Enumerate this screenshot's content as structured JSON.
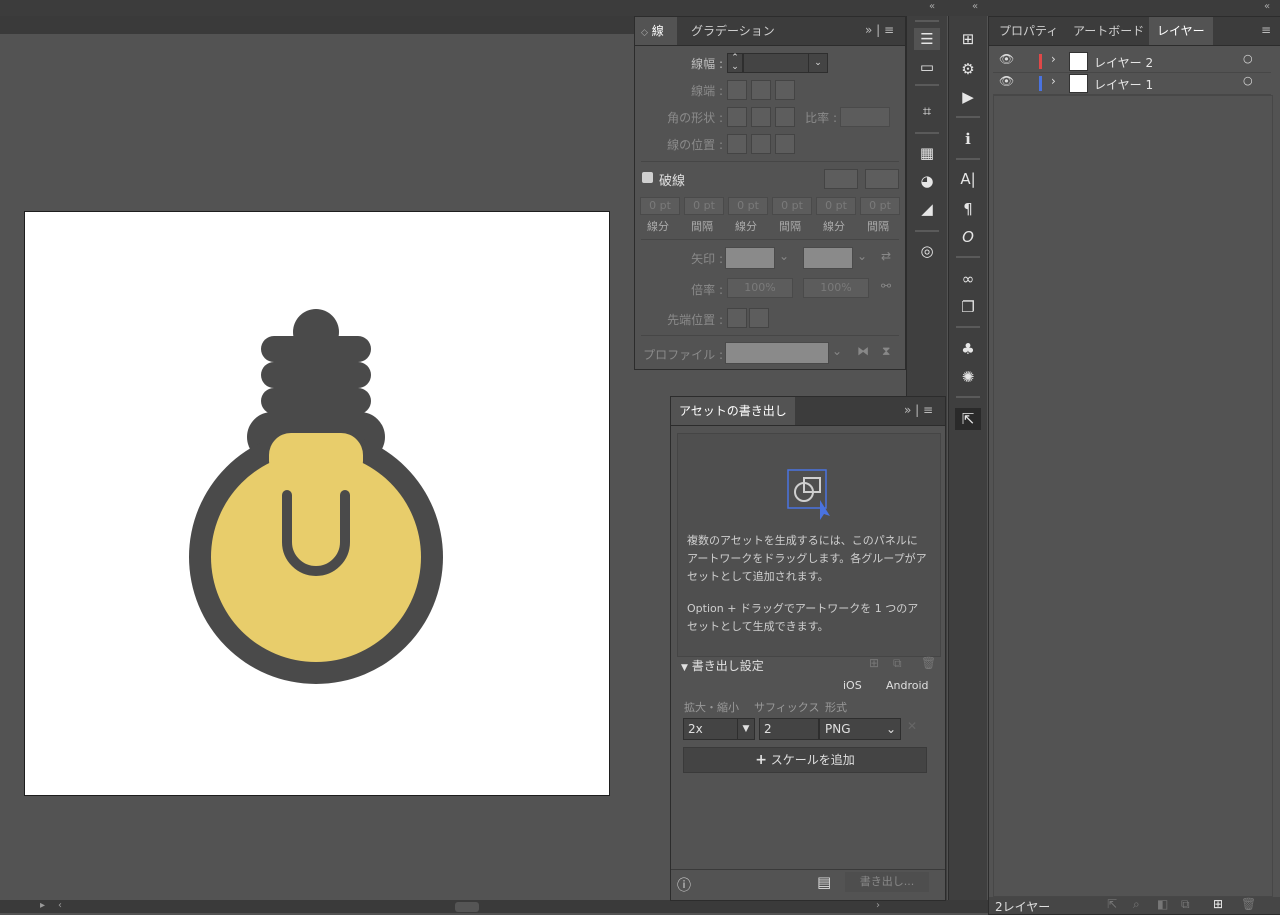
{
  "stroke_panel": {
    "tabs": [
      "線",
      "グラデーション"
    ],
    "weight_label": "線幅 :",
    "cap_label": "線端 :",
    "corner_label": "角の形状 :",
    "ratio_label": "比率 :",
    "align_label": "線の位置 :",
    "dashed_label": "破線",
    "dash_values": [
      "0 pt",
      "0 pt",
      "0 pt",
      "0 pt",
      "0 pt",
      "0 pt"
    ],
    "dash_labels": [
      "線分",
      "間隔",
      "線分",
      "間隔",
      "線分",
      "間隔"
    ],
    "arrow_label": "矢印 :",
    "scale_label": "倍率 :",
    "scale_values": [
      "100%",
      "100%"
    ],
    "tip_label": "先端位置 :",
    "profile_label": "プロファイル :"
  },
  "asset_panel": {
    "title": "アセットの書き出し",
    "help_text_1": [
      "複数のアセットを生成するには、このパネルに",
      "アートワークをドラッグします。各グループがア",
      "セットとして追加されます。"
    ],
    "help_text_2": [
      "Option + ドラッグでアートワークを 1 つのア",
      "セットとして生成できます。"
    ],
    "export_settings_label": "書き出し設定",
    "preset_ios": "iOS",
    "preset_android": "Android",
    "col_scale": "拡大・縮小",
    "col_suffix": "サフィックス",
    "col_format": "形式",
    "scale_value": "2x",
    "suffix_value": "2",
    "format_value": "PNG",
    "add_scale_label": "スケールを追加",
    "export_button": "書き出し..."
  },
  "layers_panel": {
    "tabs": [
      "プロパティ",
      "アートボード",
      "レイヤー"
    ],
    "layers": [
      {
        "name": "レイヤー 2",
        "color": "#e04848"
      },
      {
        "name": "レイヤー 1",
        "color": "#4a73e0"
      }
    ],
    "count_label": "2レイヤー"
  },
  "colors": {
    "bulb_yellow": "#e8cd6b",
    "bulb_dark": "#4a4a4a",
    "accent_blue": "#4a73e0"
  }
}
